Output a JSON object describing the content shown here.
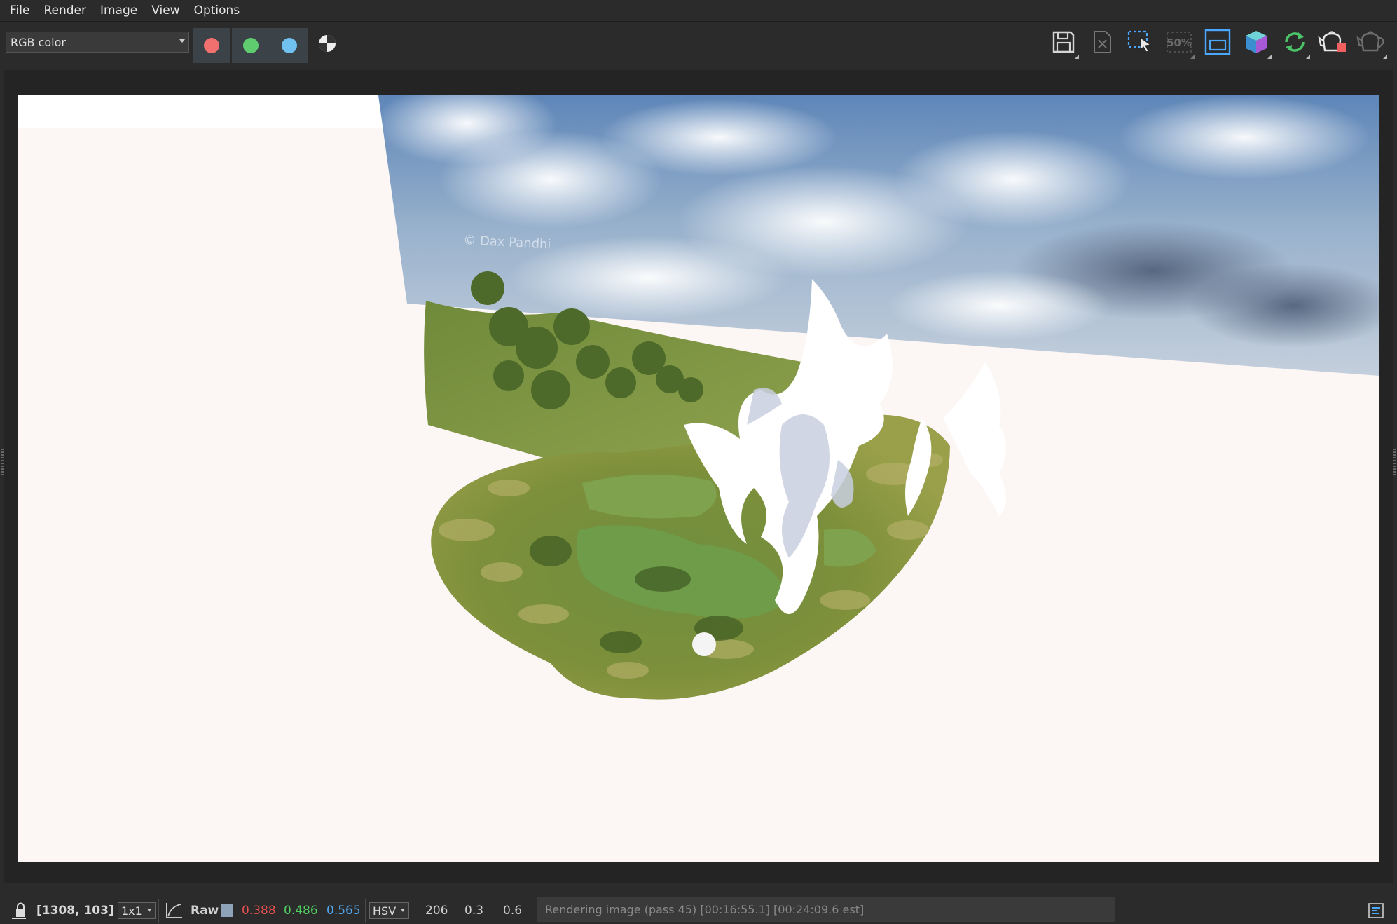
{
  "menu": {
    "items": [
      "File",
      "Render",
      "Image",
      "View",
      "Options"
    ]
  },
  "toolbar": {
    "channel_mode": "RGB color",
    "channels": [
      {
        "name": "red",
        "color": "#f07070"
      },
      {
        "name": "green",
        "color": "#60cc70"
      },
      {
        "name": "blue",
        "color": "#70c0f0"
      }
    ],
    "zoom_label": "50%",
    "tools": [
      "save-icon",
      "clear-icon",
      "region-select-icon",
      "zoom-50-icon",
      "frame-icon",
      "cube-icon",
      "refresh-icon",
      "teapot-render-icon",
      "teapot-icon"
    ]
  },
  "render": {
    "watermark": "© Dax Pandhi"
  },
  "status": {
    "coords": "[1308, 103]",
    "ratio": "1x1",
    "raw_label": "Raw",
    "r": "0.388",
    "g": "0.486",
    "b": "0.565",
    "color_space": "HSV",
    "h": "206",
    "s": "0.3",
    "v": "0.6",
    "message": "Rendering image (pass 45) [00:16:55.1] [00:24:09.6 est]",
    "colors": {
      "r": "#e85050",
      "g": "#50d060",
      "b": "#50a8f0",
      "swatch": "#8ea3b8"
    }
  }
}
